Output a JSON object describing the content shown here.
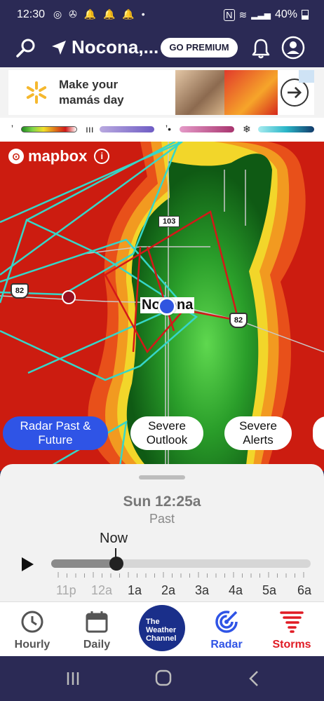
{
  "status_bar": {
    "time": "12:30",
    "left_icons": "◎ ✇ 🔔 🔔 🔔 •",
    "battery": "40%"
  },
  "header": {
    "location": "Nocona,...",
    "premium_label": "GO PREMIUM"
  },
  "ad": {
    "text": "Make your mamás day"
  },
  "map": {
    "attribution": "mapbox",
    "city_label": "Nocona",
    "route_shields": [
      "82",
      "82"
    ],
    "road_label": "103"
  },
  "layer_pills": [
    {
      "label": "Radar Past & Future",
      "active": true
    },
    {
      "label": "Severe Outlook",
      "active": false
    },
    {
      "label": "Severe Alerts",
      "active": false
    }
  ],
  "timeline": {
    "time": "Sun 12:25a",
    "mode": "Past",
    "now_label": "Now",
    "progress": 0.25,
    "hours": [
      {
        "label": "11p",
        "past": true
      },
      {
        "label": "12a",
        "past": true
      },
      {
        "label": "1a",
        "past": false
      },
      {
        "label": "2a",
        "past": false
      },
      {
        "label": "3a",
        "past": false
      },
      {
        "label": "4a",
        "past": false
      },
      {
        "label": "5a",
        "past": false
      },
      {
        "label": "6a",
        "past": false
      }
    ]
  },
  "bottom_nav": {
    "hourly": "Hourly",
    "daily": "Daily",
    "brand": "The Weather Channel",
    "radar": "Radar",
    "storms": "Storms"
  },
  "colors": {
    "active_blue": "#2f54e6",
    "storms_red": "#e01b24",
    "header_bg": "#2b2a55"
  }
}
